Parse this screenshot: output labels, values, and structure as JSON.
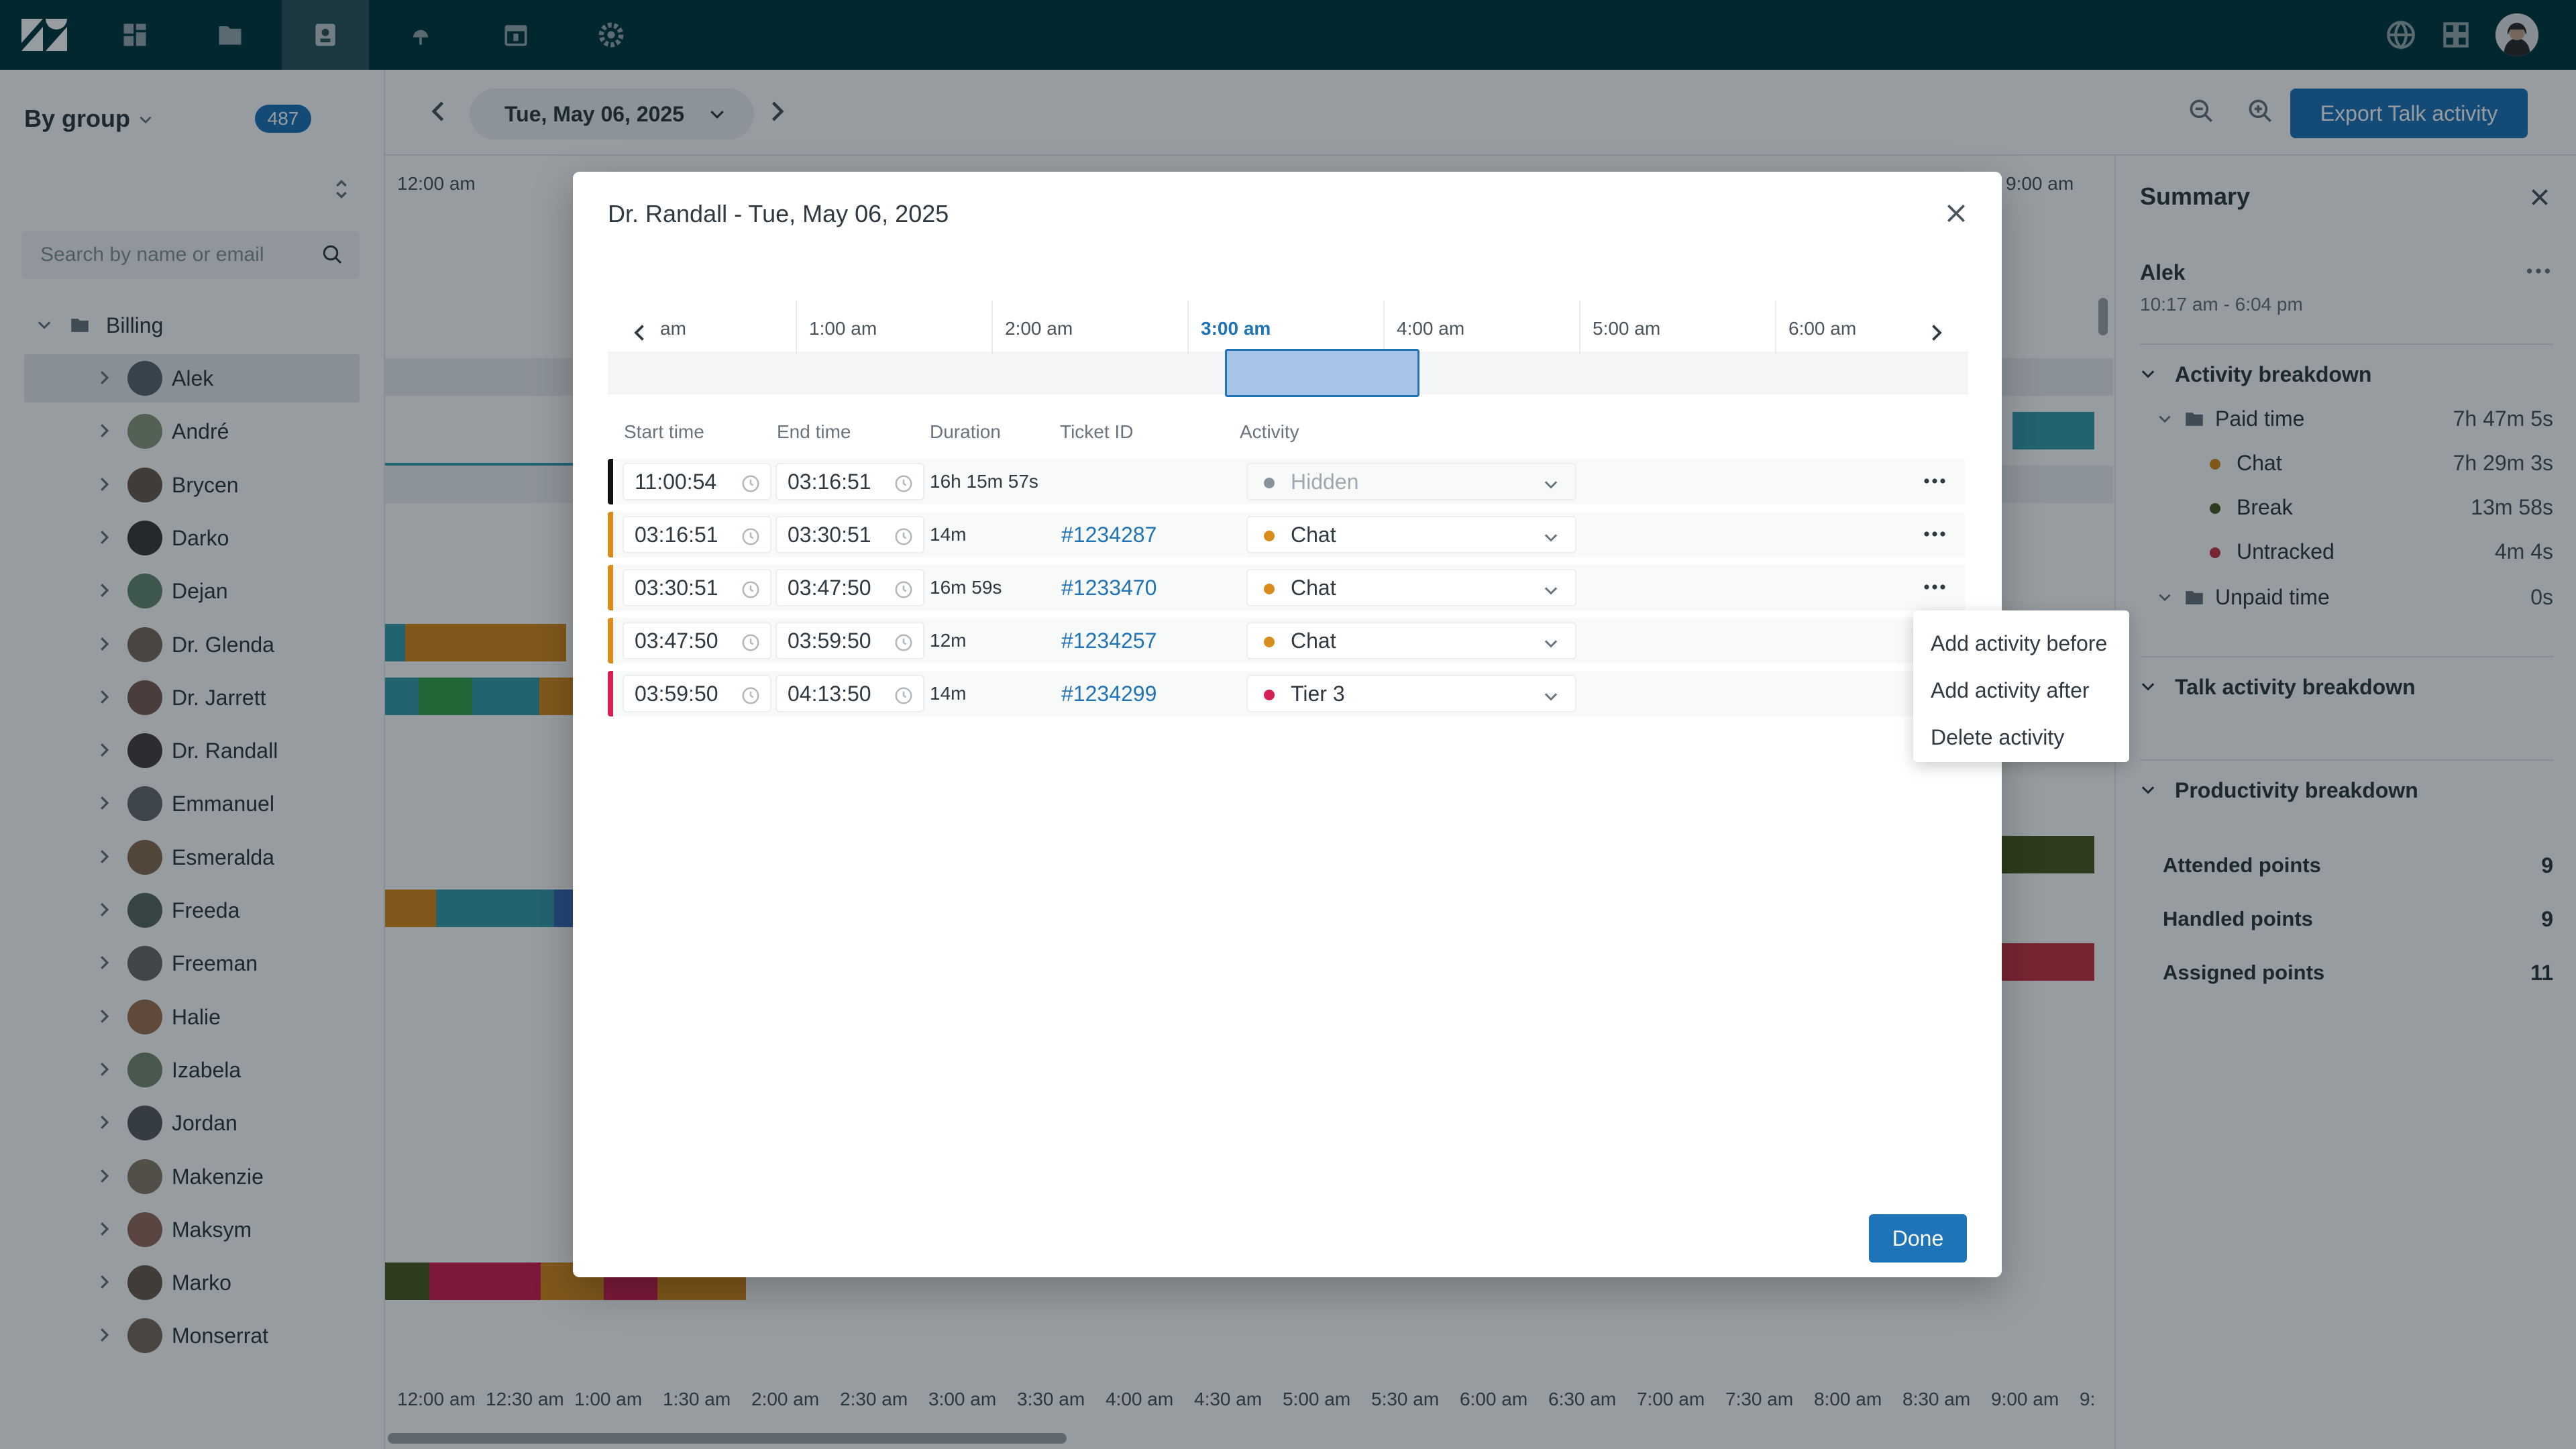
{
  "toolbar": {
    "date": "Tue, May 06, 2025",
    "export_label": "Export Talk activity"
  },
  "sidebar": {
    "group_label": "By group",
    "count": "487",
    "search_placeholder": "Search by name or email",
    "group_name": "Billing",
    "agents": [
      "Alek",
      "André",
      "Brycen",
      "Darko",
      "Dejan",
      "Dr. Glenda",
      "Dr. Jarrett",
      "Dr. Randall",
      "Emmanuel",
      "Esmeralda",
      "Freeda",
      "Freeman",
      "Halie",
      "Izabela",
      "Jordan",
      "Makenzie",
      "Maksym",
      "Marko",
      "Monserrat"
    ]
  },
  "timeline": {
    "top_hours": [
      "12:00 am",
      "9:00 am"
    ],
    "bottom_labels": [
      "12:00 am",
      "12:30 am",
      "1:00 am",
      "1:30 am",
      "2:00 am",
      "2:30 am",
      "3:00 am",
      "3:30 am",
      "4:00 am",
      "4:30 am",
      "5:00 am",
      "5:30 am",
      "6:00 am",
      "6:30 am",
      "7:00 am",
      "7:30 am",
      "8:00 am",
      "8:30 am",
      "9:00 am",
      "9:"
    ]
  },
  "summary": {
    "title": "Summary",
    "agent_name": "Alek",
    "shift": "10:17 am - 6:04 pm",
    "activity_breakdown": "Activity breakdown",
    "paid_time": {
      "label": "Paid time",
      "value": "7h 47m 5s"
    },
    "items": [
      {
        "label": "Chat",
        "value": "7h 29m 3s",
        "color": "#d98b1c"
      },
      {
        "label": "Break",
        "value": "13m 58s",
        "color": "#4a5a1e"
      },
      {
        "label": "Untracked",
        "value": "4m 4s",
        "color": "#cc3340"
      }
    ],
    "unpaid_time": {
      "label": "Unpaid time",
      "value": "0s"
    },
    "talk_breakdown": "Talk activity breakdown",
    "productivity_breakdown": "Productivity breakdown",
    "points": [
      {
        "label": "Attended points",
        "value": "9"
      },
      {
        "label": "Handled points",
        "value": "9"
      },
      {
        "label": "Assigned points",
        "value": "11"
      }
    ]
  },
  "modal": {
    "title": "Dr. Randall - Tue, May 06, 2025",
    "hours": [
      "am",
      "1:00 am",
      "2:00 am",
      "3:00 am",
      "4:00 am",
      "5:00 am",
      "6:00 am"
    ],
    "headers": {
      "start": "Start time",
      "end": "End time",
      "duration": "Duration",
      "ticket": "Ticket ID",
      "activity": "Activity"
    },
    "rows": [
      {
        "start": "11:00:54",
        "end": "03:16:51",
        "duration": "16h 15m 57s",
        "ticket": "",
        "activity": "Hidden",
        "color": "#111111",
        "dot": "#87929d"
      },
      {
        "start": "03:16:51",
        "end": "03:30:51",
        "duration": "14m",
        "ticket": "#1234287",
        "activity": "Chat",
        "color": "#d98b1c",
        "dot": "#d98b1c"
      },
      {
        "start": "03:30:51",
        "end": "03:47:50",
        "duration": "16m 59s",
        "ticket": "#1233470",
        "activity": "Chat",
        "color": "#d98b1c",
        "dot": "#d98b1c"
      },
      {
        "start": "03:47:50",
        "end": "03:59:50",
        "duration": "12m",
        "ticket": "#1234257",
        "activity": "Chat",
        "color": "#d98b1c",
        "dot": "#d98b1c"
      },
      {
        "start": "03:59:50",
        "end": "04:13:50",
        "duration": "14m",
        "ticket": "#1234299",
        "activity": "Tier 3",
        "color": "#d42054",
        "dot": "#d42054"
      }
    ],
    "done_label": "Done"
  },
  "menu": {
    "items": [
      "Add activity before",
      "Add activity after",
      "Delete activity"
    ]
  }
}
